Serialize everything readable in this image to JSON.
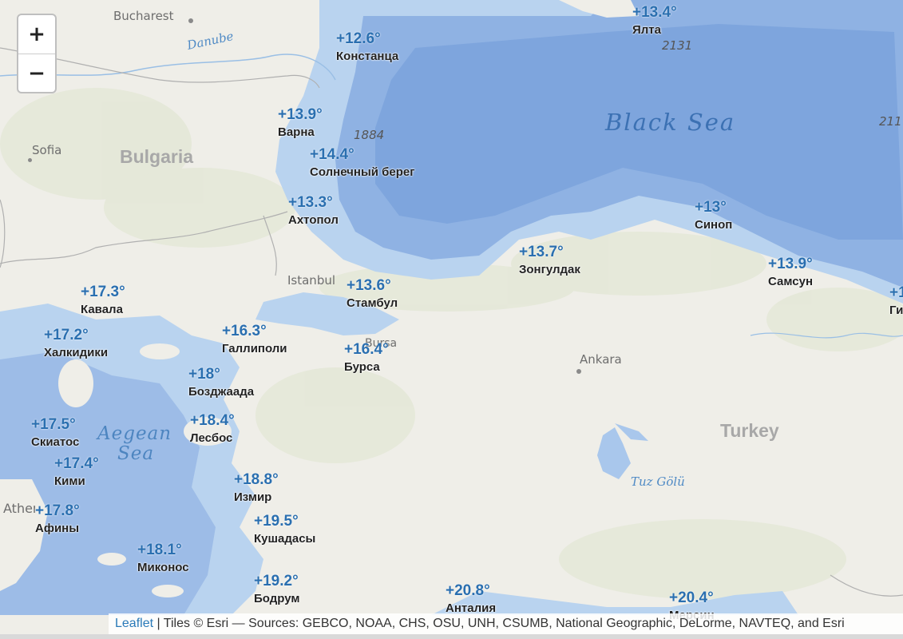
{
  "controls": {
    "zoom_in": "+",
    "zoom_out": "−"
  },
  "seas": {
    "black_sea": "Black Sea",
    "aegean_line1": "Aegean",
    "aegean_line2": "Sea"
  },
  "countries": {
    "bulgaria": "Bulgaria",
    "turkey": "Turkey"
  },
  "cities": {
    "bucharest": "Bucharest",
    "sofia": "Sofia",
    "istanbul": "Istanbul",
    "ankara": "Ankara",
    "bursa": "Bursa",
    "athens": "Athens"
  },
  "water_labels": {
    "danube": "Danube",
    "tuz": "Tuz Gölü"
  },
  "depths": {
    "d1": "2131",
    "d2": "1884",
    "d3": "211"
  },
  "markers": [
    {
      "id": "yalta",
      "temp": "+13.4°",
      "name": "Ялта"
    },
    {
      "id": "constanta",
      "temp": "+12.6°",
      "name": "Констанца"
    },
    {
      "id": "varna",
      "temp": "+13.9°",
      "name": "Варна"
    },
    {
      "id": "sunny-beach",
      "temp": "+14.4°",
      "name": "Солнечный берег"
    },
    {
      "id": "ahtopol",
      "temp": "+13.3°",
      "name": "Ахтопол"
    },
    {
      "id": "sinop",
      "temp": "+13°",
      "name": "Синоп"
    },
    {
      "id": "zonguldak",
      "temp": "+13.7°",
      "name": "Зонгулдак"
    },
    {
      "id": "samsun",
      "temp": "+13.9°",
      "name": "Самсун"
    },
    {
      "id": "giresun",
      "temp": "+1",
      "name": "Ги"
    },
    {
      "id": "istanbul",
      "temp": "+13.6°",
      "name": "Стамбул"
    },
    {
      "id": "kavala",
      "temp": "+17.3°",
      "name": "Кавала"
    },
    {
      "id": "halkidiki",
      "temp": "+17.2°",
      "name": "Халкидики"
    },
    {
      "id": "gallipoli",
      "temp": "+16.3°",
      "name": "Галлиполи"
    },
    {
      "id": "bursa",
      "temp": "+16.4°",
      "name": "Бурса"
    },
    {
      "id": "bozcaada",
      "temp": "+18°",
      "name": "Бозджаада"
    },
    {
      "id": "skiathos",
      "temp": "+17.5°",
      "name": "Скиатос"
    },
    {
      "id": "lesbos",
      "temp": "+18.4°",
      "name": "Лесбос"
    },
    {
      "id": "kymi",
      "temp": "+17.4°",
      "name": "Кими"
    },
    {
      "id": "izmir",
      "temp": "+18.8°",
      "name": "Измир"
    },
    {
      "id": "athens",
      "temp": "+17.8°",
      "name": "Афины"
    },
    {
      "id": "kusadasi",
      "temp": "+19.5°",
      "name": "Кушадасы"
    },
    {
      "id": "mykonos",
      "temp": "+18.1°",
      "name": "Миконос"
    },
    {
      "id": "bodrum",
      "temp": "+19.2°",
      "name": "Бодрум"
    },
    {
      "id": "antalya",
      "temp": "+20.8°",
      "name": "Анталия"
    },
    {
      "id": "mersin",
      "temp": "+20.4°",
      "name": "Мерсин"
    }
  ],
  "attribution": {
    "link": "Leaflet",
    "text": " | Tiles © Esri — Sources: GEBCO, NOAA, CHS, OSU, UNH, CSUMB, National Geographic, DeLorme, NAVTEQ, and Esri"
  },
  "colors": {
    "deep_water": "#7ea5dd",
    "shallow_water": "#b9d3ef",
    "land": "#efeee8",
    "temp_text": "#2a6fb0"
  }
}
